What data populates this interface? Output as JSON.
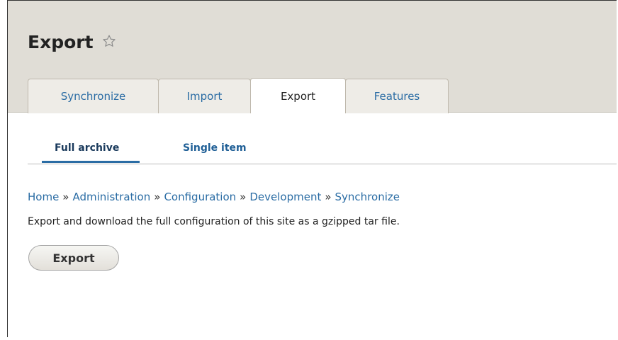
{
  "page": {
    "title": "Export"
  },
  "tabs": [
    {
      "label": "Synchronize",
      "active": false
    },
    {
      "label": "Import",
      "active": false
    },
    {
      "label": "Export",
      "active": true
    },
    {
      "label": "Features",
      "active": false
    }
  ],
  "subtabs": [
    {
      "label": "Full archive",
      "active": true
    },
    {
      "label": "Single item",
      "active": false
    }
  ],
  "breadcrumb": {
    "items": [
      "Home",
      "Administration",
      "Configuration",
      "Development",
      "Synchronize"
    ],
    "separator": "»"
  },
  "content": {
    "description": "Export and download the full configuration of this site as a gzipped tar file.",
    "export_button": "Export"
  },
  "icons": {
    "star": "star-outline-icon"
  },
  "colors": {
    "link": "#2a6ca4",
    "header_bg": "#e0ddd6",
    "tab_bg": "#eeece7"
  }
}
